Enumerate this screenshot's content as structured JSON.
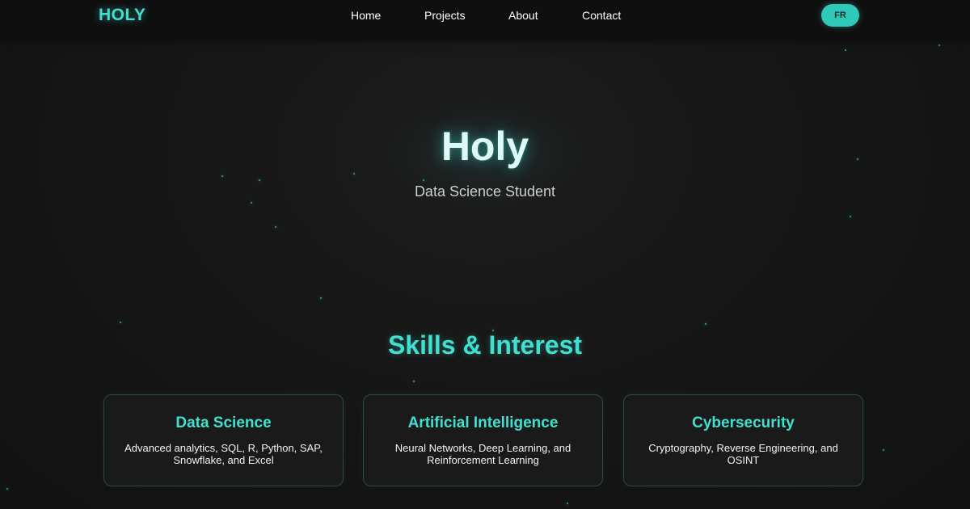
{
  "navbar": {
    "logo": "HOLY",
    "links": [
      {
        "label": "Home"
      },
      {
        "label": "Projects"
      },
      {
        "label": "About"
      },
      {
        "label": "Contact"
      }
    ],
    "lang_button": "FR"
  },
  "hero": {
    "title": "Holy",
    "subtitle": "Data Science Student"
  },
  "skills": {
    "title": "Skills & Interest",
    "cards": [
      {
        "title": "Data Science",
        "description": "Advanced analytics, SQL, R, Python, SAP, Snowflake, and Excel"
      },
      {
        "title": "Artificial Intelligence",
        "description": "Neural Networks, Deep Learning, and Reinforcement Learning"
      },
      {
        "title": "Cybersecurity",
        "description": "Cryptography, Reverse Engineering, and OSINT"
      }
    ]
  },
  "colors": {
    "accent": "#40e0d0",
    "background": "#151515",
    "navbar": "#0f0f0f"
  }
}
